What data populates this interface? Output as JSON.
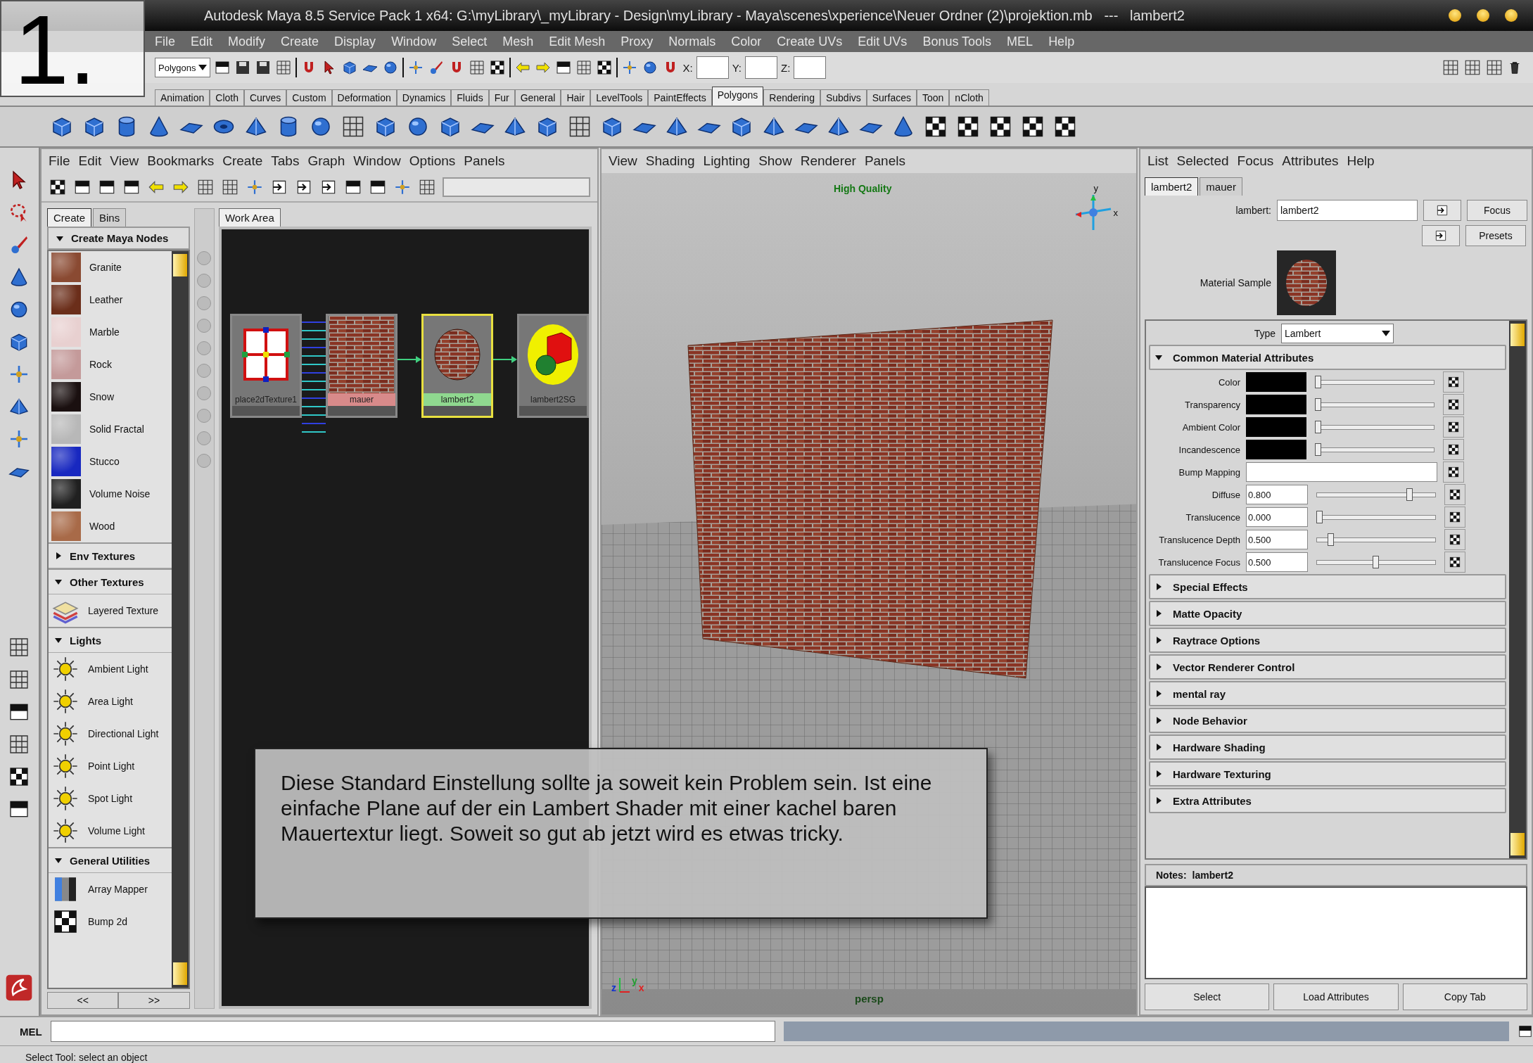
{
  "window": {
    "title": "Autodesk Maya 8.5 Service Pack 1 x64: G:\\myLibrary\\_myLibrary - Design\\myLibrary - Maya\\scenes\\xperience\\Neuer Ordner (2)\\projektion.mb   ---   lambert2"
  },
  "overlay_badge": {
    "text": "1."
  },
  "menu_bar": [
    "File",
    "Edit",
    "Modify",
    "Create",
    "Display",
    "Window",
    "Select",
    "Mesh",
    "Edit Mesh",
    "Proxy",
    "Normals",
    "Color",
    "Create UVs",
    "Edit UVs",
    "Bonus Tools",
    "MEL",
    "Help"
  ],
  "toolbar": {
    "mode_dropdown": "Polygons",
    "x_label": "X:",
    "y_label": "Y:",
    "z_label": "Z:"
  },
  "shelf_tabs": [
    {
      "label": "Animation",
      "selected": false
    },
    {
      "label": "Cloth",
      "selected": false
    },
    {
      "label": "Curves",
      "selected": false
    },
    {
      "label": "Custom",
      "selected": false
    },
    {
      "label": "Deformation",
      "selected": false
    },
    {
      "label": "Dynamics",
      "selected": false
    },
    {
      "label": "Fluids",
      "selected": false
    },
    {
      "label": "Fur",
      "selected": false
    },
    {
      "label": "General",
      "selected": false
    },
    {
      "label": "Hair",
      "selected": false
    },
    {
      "label": "LevelTools",
      "selected": false
    },
    {
      "label": "PaintEffects",
      "selected": false
    },
    {
      "label": "Polygons",
      "selected": true
    },
    {
      "label": "Rendering",
      "selected": false
    },
    {
      "label": "Subdivs",
      "selected": false
    },
    {
      "label": "Surfaces",
      "selected": false
    },
    {
      "label": "Toon",
      "selected": false
    },
    {
      "label": "nCloth",
      "selected": false
    }
  ],
  "hypershade": {
    "menu": [
      "File",
      "Edit",
      "View",
      "Bookmarks",
      "Create",
      "Tabs",
      "Graph",
      "Window",
      "Options",
      "Panels"
    ],
    "tabs": [
      {
        "label": "Create",
        "selected": true
      },
      {
        "label": "Bins",
        "selected": false
      }
    ],
    "section": {
      "title": "Create Maya Nodes",
      "expanded": true
    },
    "items": [
      {
        "label": "Granite",
        "color": "#8a4a32"
      },
      {
        "label": "Leather",
        "color": "#6b2e1a"
      },
      {
        "label": "Marble",
        "color": "#e8d0d0"
      },
      {
        "label": "Rock",
        "color": "#c49a9a"
      },
      {
        "label": "Snow",
        "color": "#1a1010"
      },
      {
        "label": "Solid Fractal",
        "color": "#b8b8b8"
      },
      {
        "label": "Stucco",
        "color": "#1828c0"
      },
      {
        "label": "Volume Noise",
        "color": "#202020"
      },
      {
        "label": "Wood",
        "color": "#a86a48"
      }
    ],
    "groups": [
      {
        "title": "Env Textures",
        "expanded": false
      },
      {
        "title": "Other Textures",
        "expanded": true,
        "items": [
          {
            "label": "Layered Texture",
            "kind": "layered"
          }
        ]
      },
      {
        "title": "Lights",
        "expanded": true,
        "items": [
          {
            "label": "Ambient Light",
            "kind": "light"
          },
          {
            "label": "Area Light",
            "kind": "light"
          },
          {
            "label": "Directional Light",
            "kind": "light"
          },
          {
            "label": "Point Light",
            "kind": "light"
          },
          {
            "label": "Spot Light",
            "kind": "light"
          },
          {
            "label": "Volume Light",
            "kind": "light"
          }
        ]
      },
      {
        "title": "General Utilities",
        "expanded": true,
        "items": [
          {
            "label": "Array Mapper",
            "kind": "utility"
          },
          {
            "label": "Bump 2d",
            "kind": "checker"
          }
        ]
      }
    ],
    "nav_buttons": [
      "<<",
      ">>"
    ],
    "work_area_tab": "Work Area",
    "nodes": [
      {
        "label": "place2dTexture1",
        "kind": "place2d",
        "selected": false
      },
      {
        "label": "mauer",
        "kind": "texture",
        "selected": false
      },
      {
        "label": "lambert2",
        "kind": "shader",
        "selected": true
      },
      {
        "label": "lambert2SG",
        "kind": "shading_group",
        "selected": false
      }
    ]
  },
  "viewport": {
    "menu": [
      "View",
      "Shading",
      "Lighting",
      "Show",
      "Renderer",
      "Panels"
    ],
    "quality_label": "High Quality",
    "gizmo_labels": [
      "y",
      "x"
    ],
    "axis_labels": [
      "y",
      "z",
      "x"
    ],
    "camera_label": "persp"
  },
  "attribute_editor": {
    "menu": [
      "List",
      "Selected",
      "Focus",
      "Attributes",
      "Help"
    ],
    "tabs": [
      {
        "label": "lambert2",
        "selected": true
      },
      {
        "label": "mauer",
        "selected": false
      }
    ],
    "node_label": "lambert:",
    "node_name": "lambert2",
    "buttons": [
      "Focus",
      "Presets"
    ],
    "sample_label": "Material Sample",
    "type_label": "Type",
    "type_value": "Lambert",
    "sections": [
      {
        "title": "Common Material Attributes",
        "expanded": true,
        "attributes": [
          {
            "label": "Color",
            "kind": "color",
            "level": 0
          },
          {
            "label": "Transparency",
            "kind": "color",
            "level": 0
          },
          {
            "label": "Ambient Color",
            "kind": "color",
            "level": 0
          },
          {
            "label": "Incandescence",
            "kind": "color",
            "level": 0
          },
          {
            "label": "Bump Mapping",
            "kind": "map"
          },
          {
            "label": "Diffuse",
            "kind": "number",
            "value": "0.800",
            "level": 0.8
          },
          {
            "label": "Translucence",
            "kind": "number",
            "value": "0.000",
            "level": 0
          },
          {
            "label": "Translucence Depth",
            "kind": "number",
            "value": "0.500",
            "level": 0.1
          },
          {
            "label": "Translucence Focus",
            "kind": "number",
            "value": "0.500",
            "level": 0.5
          }
        ]
      },
      {
        "title": "Special Effects",
        "expanded": false
      },
      {
        "title": "Matte Opacity",
        "expanded": false
      },
      {
        "title": "Raytrace Options",
        "expanded": false
      },
      {
        "title": "Vector Renderer Control",
        "expanded": false
      },
      {
        "title": "mental ray",
        "expanded": false
      },
      {
        "title": "Node Behavior",
        "expanded": false
      },
      {
        "title": "Hardware Shading",
        "expanded": false
      },
      {
        "title": "Hardware Texturing",
        "expanded": false
      },
      {
        "title": "Extra Attributes",
        "expanded": false
      }
    ],
    "notes_label": "Notes:",
    "notes_node": "lambert2",
    "bottom_buttons": [
      "Select",
      "Load Attributes",
      "Copy Tab"
    ]
  },
  "command_line": {
    "label": "MEL"
  },
  "status_bar": "Select Tool: select an object",
  "annotation": {
    "text": "Diese Standard Einstellung sollte ja soweit kein Problem sein. Ist eine einfache Plane auf der ein Lambert Shader mit einer kachel baren Mauertextur liegt. Soweit so gut ab jetzt wird es etwas tricky."
  }
}
